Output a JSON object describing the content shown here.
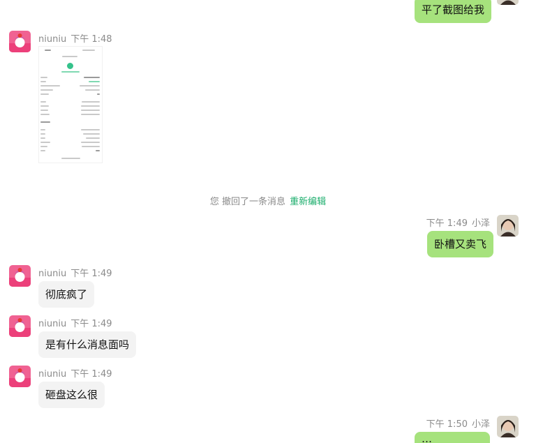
{
  "conversation": {
    "messages": [
      {
        "type": "out",
        "text": "平了截图给我"
      },
      {
        "type": "in",
        "sender": "niuniu",
        "time": "下午 1:48",
        "kind": "image",
        "image_alt": "交易记录截图"
      },
      {
        "type": "system",
        "text": "您 撤回了一条消息",
        "action": "重新编辑"
      },
      {
        "type": "out",
        "sender": "小泽",
        "time": "下午 1:49",
        "text": "卧槽又卖飞"
      },
      {
        "type": "in",
        "sender": "niuniu",
        "time": "下午 1:49",
        "text": "彻底疯了"
      },
      {
        "type": "in",
        "sender": "niuniu",
        "time": "下午 1:49",
        "text": "是有什么消息面吗"
      },
      {
        "type": "in",
        "sender": "niuniu",
        "time": "下午 1:49",
        "text": "砸盘这么很"
      },
      {
        "type": "out",
        "sender": "小泽",
        "time": "下午 1:50",
        "text": "…"
      }
    ]
  },
  "colors": {
    "out_bubble": "#a6e27d",
    "in_bubble": "#f3f3f3",
    "system_link": "#1aad6b",
    "meta_text": "#8a8a8a"
  }
}
